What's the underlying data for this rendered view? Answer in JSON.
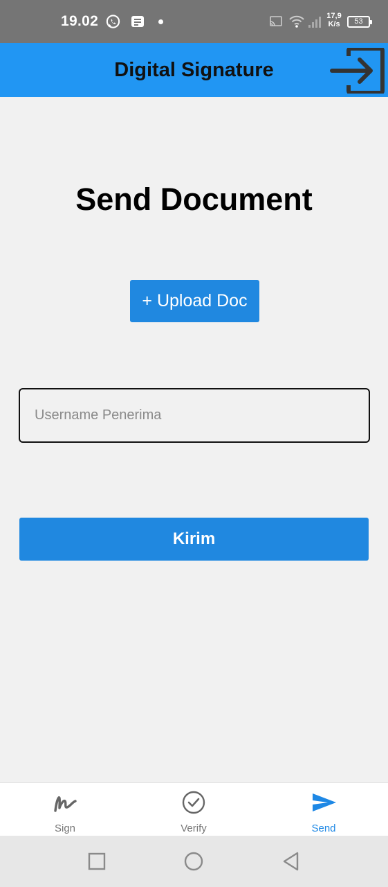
{
  "status_bar": {
    "time": "19.02",
    "speed_value": "17,9",
    "speed_unit": "K/s",
    "battery": "53",
    "icons": [
      "whatsapp-icon",
      "message-icon",
      "notification-dot",
      "cast-icon",
      "wifi-icon",
      "signal-icon",
      "battery-icon"
    ]
  },
  "app_bar": {
    "title": "Digital Signature",
    "action_icon": "logout-icon",
    "color": "#2196f3"
  },
  "main": {
    "title": "Send Document",
    "upload_label": "+ Upload Doc",
    "recipient_placeholder": "Username Penerima",
    "recipient_value": "",
    "submit_label": "Kirim",
    "button_color": "#2088e0"
  },
  "bottom_nav": {
    "items": [
      {
        "label": "Sign",
        "icon": "signature-icon",
        "active": false
      },
      {
        "label": "Verify",
        "icon": "check-circle-icon",
        "active": false
      },
      {
        "label": "Send",
        "icon": "send-icon",
        "active": true
      }
    ],
    "active_color": "#1e88e5"
  },
  "system_nav": {
    "icons": [
      "recent-apps-icon",
      "home-icon",
      "back-icon"
    ]
  }
}
